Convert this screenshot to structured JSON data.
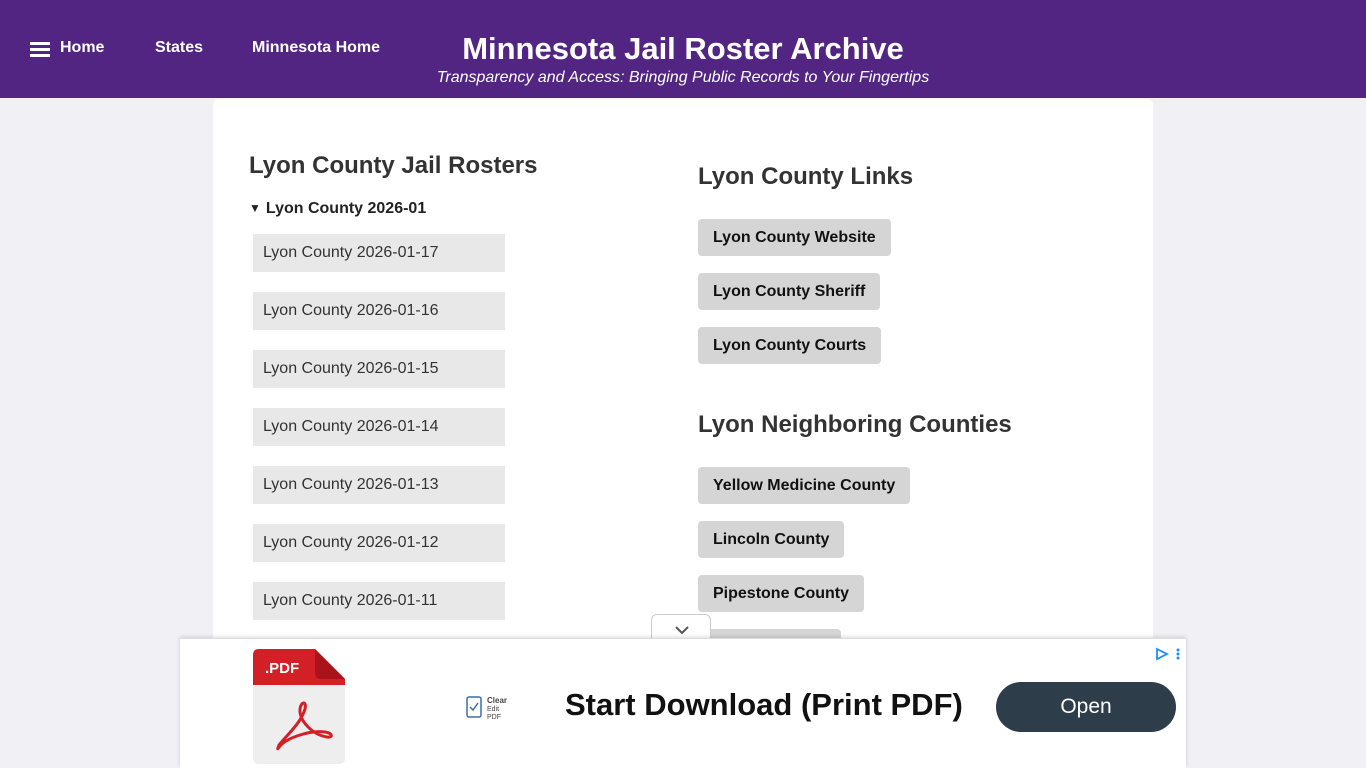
{
  "header": {
    "nav": {
      "home": "Home",
      "states": "States",
      "minnesota_home": "Minnesota Home"
    },
    "title": "Minnesota Jail Roster Archive",
    "subtitle": "Transparency and Access: Bringing Public Records to Your Fingertips",
    "bg_color": "#522583"
  },
  "rosters": {
    "heading": "Lyon County Jail Rosters",
    "month_label": "Lyon County 2026-01",
    "items": [
      "Lyon County 2026-01-17",
      "Lyon County 2026-01-16",
      "Lyon County 2026-01-15",
      "Lyon County 2026-01-14",
      "Lyon County 2026-01-13",
      "Lyon County 2026-01-12",
      "Lyon County 2026-01-11"
    ]
  },
  "links": {
    "heading": "Lyon County Links",
    "items": [
      "Lyon County Website",
      "Lyon County Sheriff",
      "Lyon County Courts"
    ]
  },
  "neighbors": {
    "heading": "Lyon Neighboring Counties",
    "items": [
      "Yellow Medicine County",
      "Lincoln County",
      "Pipestone County"
    ]
  },
  "ad": {
    "pdf_badge": ".PDF",
    "logo_text": "Clear Edit PDF",
    "headline": "Start Download (Print PDF)",
    "cta": "Open"
  }
}
